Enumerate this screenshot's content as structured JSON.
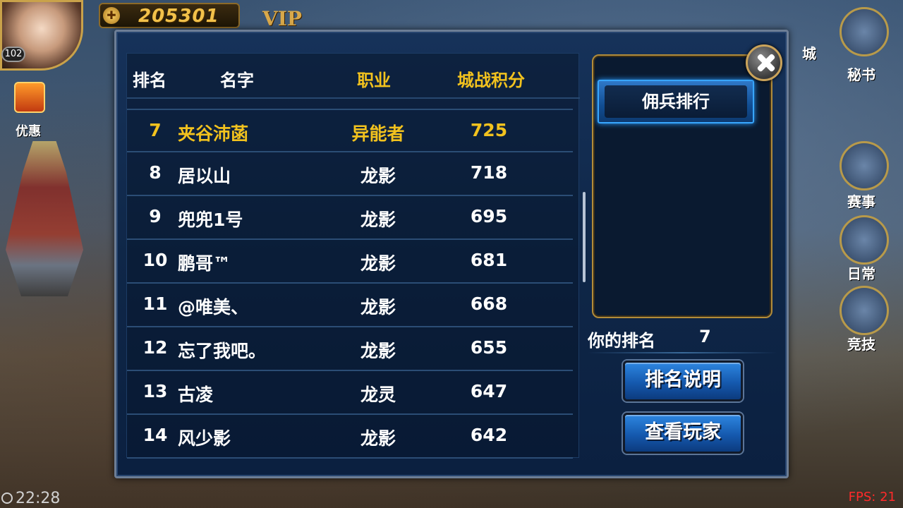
{
  "hud": {
    "level": "102",
    "gold": "205301",
    "vip": "VIP",
    "left_menu": {
      "gift_label": "优惠"
    },
    "right_menu": [
      "秘书",
      "赛事",
      "日常",
      "竞技"
    ],
    "right_menu_top": "城",
    "clock": "22:28",
    "fps": "FPS: 21"
  },
  "ranking": {
    "headers": {
      "rank": "排名",
      "name": "名字",
      "job": "职业",
      "score": "城战积分"
    },
    "rows": [
      {
        "rank": "7",
        "name": "夹谷沛菡",
        "job": "异能者",
        "score": "725",
        "self": true
      },
      {
        "rank": "8",
        "name": "居以山",
        "job": "龙影",
        "score": "718"
      },
      {
        "rank": "9",
        "name": "兜兜1号",
        "job": "龙影",
        "score": "695"
      },
      {
        "rank": "10",
        "name": "鹏哥™",
        "job": "龙影",
        "score": "681"
      },
      {
        "rank": "11",
        "name": "@唯美、",
        "job": "龙影",
        "score": "668"
      },
      {
        "rank": "12",
        "name": "忘了我吧。",
        "job": "龙影",
        "score": "655"
      },
      {
        "rank": "13",
        "name": "古凌",
        "job": "龙灵",
        "score": "647"
      },
      {
        "rank": "14",
        "name": "风少影",
        "job": "龙影",
        "score": "642"
      }
    ],
    "tab_label": "佣兵排行",
    "my_rank_label": "你的排名",
    "my_rank_value": "7",
    "explain_button": "排名说明",
    "view_button": "查看玩家"
  },
  "colors": {
    "highlight": "#f2c21e",
    "panel_bg": "#0f2748",
    "button_blue": "#1559ae",
    "fps_red": "#ff2a2a"
  }
}
